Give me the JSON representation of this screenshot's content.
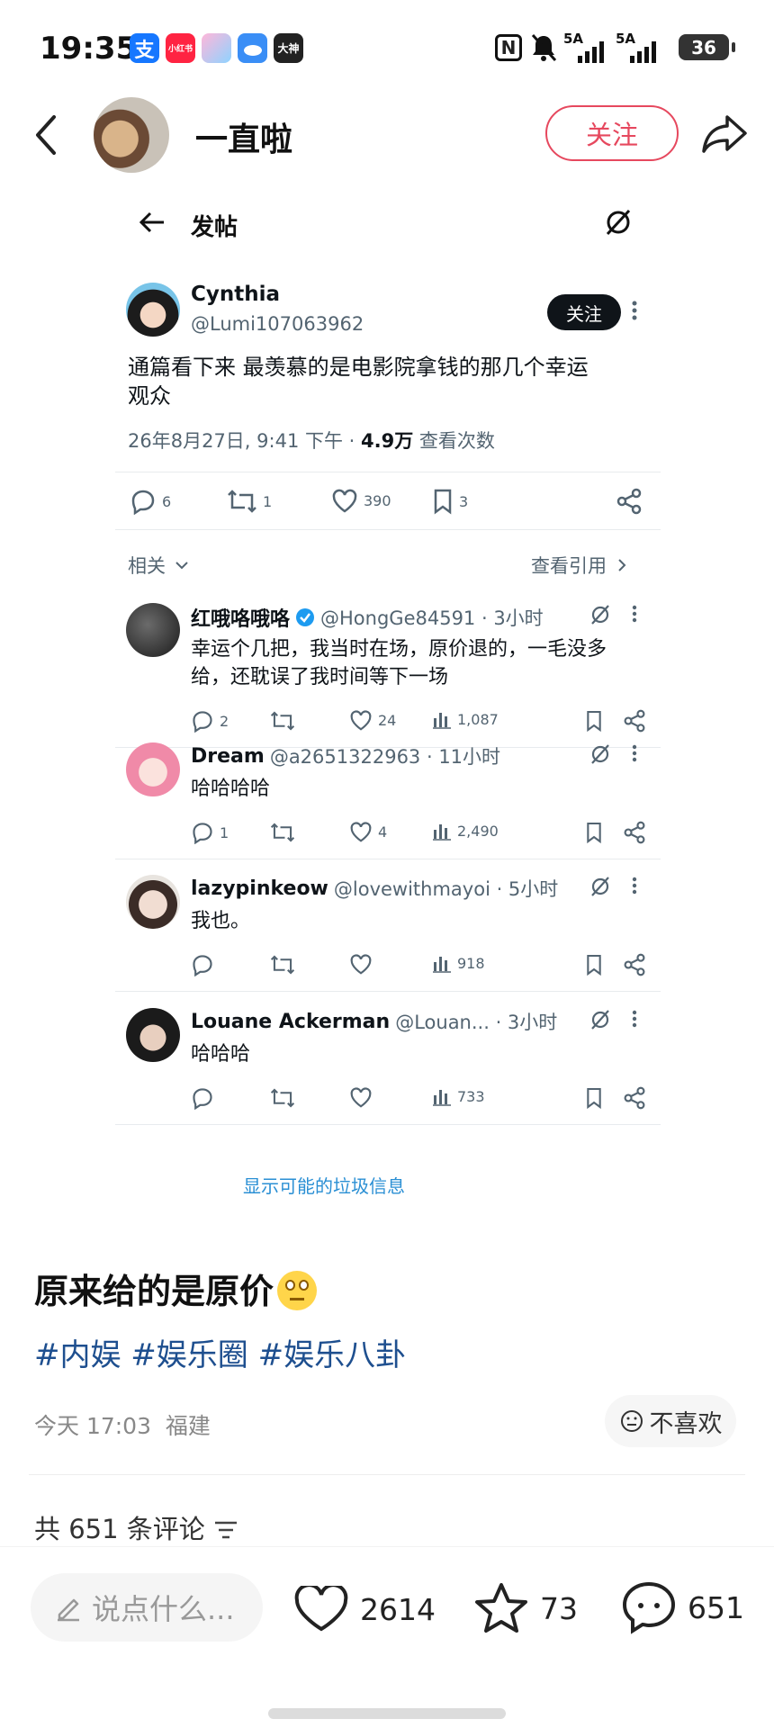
{
  "status_bar": {
    "time": "19:35",
    "app_icons": [
      "支",
      "小红书",
      "",
      "",
      "大神"
    ],
    "signal1": "5A",
    "signal2": "5A",
    "battery": "36"
  },
  "header": {
    "username": "一直啦",
    "follow_label": "关注"
  },
  "shot": {
    "title": "发帖",
    "tweet": {
      "name": "Cynthia",
      "handle": "@Lumi107063962",
      "follow_label": "关注",
      "text_line1": "通篇看下来 最羡慕的是电影院拿钱的那几个幸运",
      "text_line2": "观众",
      "meta_date": "26年8月27日, 9:41 下午 · ",
      "meta_views": "4.9万",
      "meta_views_label": " 查看次数",
      "replies": "6",
      "retweets": "1",
      "likes": "390",
      "bookmarks": "3"
    },
    "related_label": "相关",
    "quotes_label": "查看引用",
    "replies": [
      {
        "name": "红哦咯哦咯",
        "handle": "@HongGe84591 · 3小时",
        "line1": "幸运个几把，我当时在场，原价退的，一毛没多",
        "line2": "给，还耽误了我时间等下一场",
        "reply": "2",
        "retweet": "",
        "like": "24",
        "views": "1,087"
      },
      {
        "name": "Dream",
        "handle": "@a2651322963 · 11小时",
        "line1": "哈哈哈哈",
        "line2": "",
        "reply": "1",
        "retweet": "",
        "like": "4",
        "views": "2,490"
      },
      {
        "name": "lazypinkeow",
        "handle": "@lovewithmayoi · 5小时",
        "line1": "我也。",
        "line2": "",
        "reply": "",
        "retweet": "",
        "like": "",
        "views": "918"
      },
      {
        "name": "Louane Ackerman",
        "handle": "@Louan... · 3小时",
        "line1": "哈哈哈",
        "line2": "",
        "reply": "",
        "retweet": "",
        "like": "",
        "views": "733"
      }
    ],
    "spam_label": "显示可能的垃圾信息"
  },
  "post": {
    "title": "原来给的是原价",
    "emoji": "🙄",
    "tags": "#内娱 #娱乐圈 #娱乐八卦",
    "time": "今天 17:03",
    "location": "福建",
    "dislike_label": "不喜欢",
    "comment_count_label": "共 651 条评论"
  },
  "bottom": {
    "input_placeholder": "说点什么...",
    "likes": "2614",
    "stars": "73",
    "comments": "651"
  },
  "colors": {
    "accent": "#e6485e",
    "link": "#1e4f8f",
    "twitter_blue": "#1d9bf0"
  }
}
